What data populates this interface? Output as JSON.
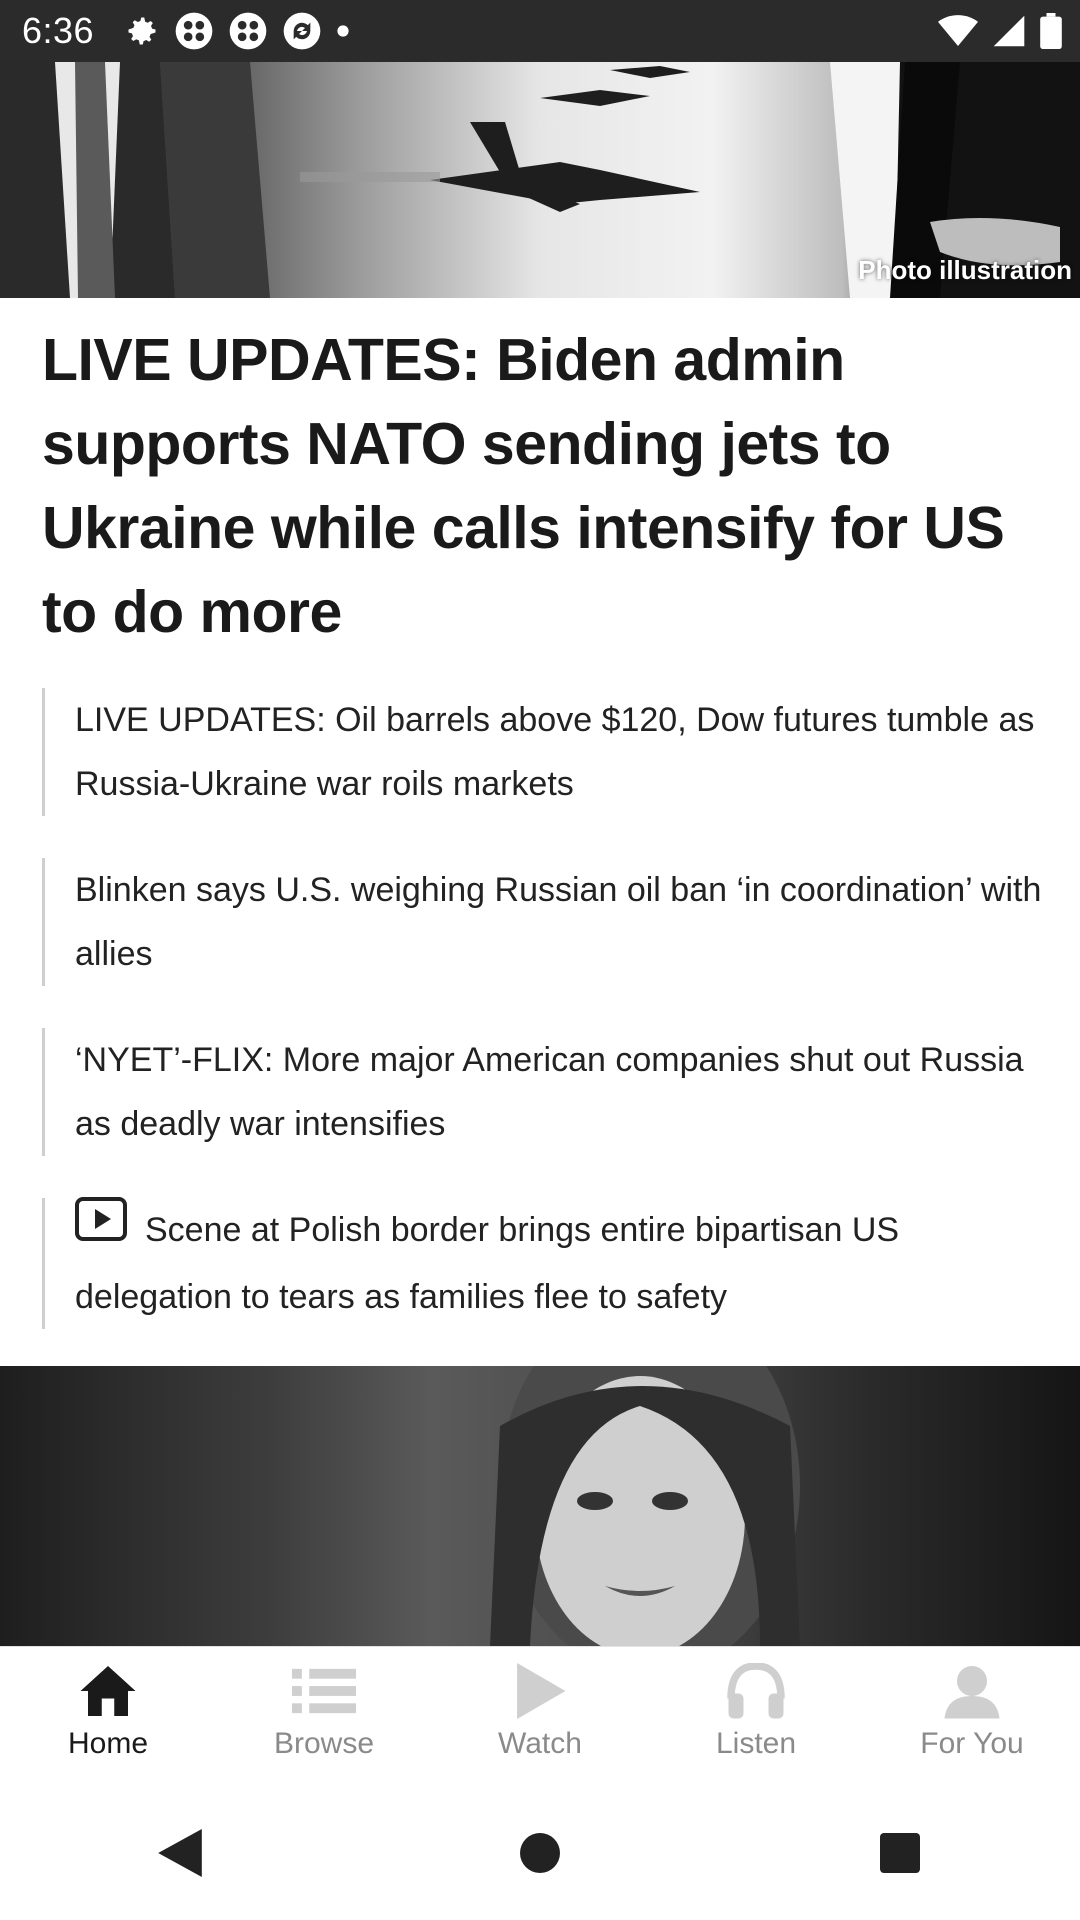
{
  "status_bar": {
    "time": "6:36",
    "left_icons": [
      "gear-icon",
      "app-icon",
      "app-icon",
      "sync-icon",
      "dot-icon"
    ],
    "right_icons": [
      "wifi-icon",
      "signal-icon",
      "battery-icon"
    ]
  },
  "hero": {
    "caption": "Photo illustration"
  },
  "article": {
    "headline": "LIVE UPDATES: Biden admin supports NATO sending jets to Ukraine while calls intensify for US to do more",
    "related": [
      {
        "text": "LIVE UPDATES: Oil barrels above $120, Dow futures tumble as Russia-Ukraine war roils markets",
        "video": false
      },
      {
        "text": "Blinken says U.S. weighing Russian oil ban ‘in coordination’ with allies",
        "video": false
      },
      {
        "text": "‘NYET’-FLIX: More major American companies shut out Russia as deadly war intensifies",
        "video": false
      },
      {
        "text": "Scene at Polish border brings entire bipartisan US delegation to tears as families flee to safety",
        "video": true
      }
    ]
  },
  "bottom_nav": {
    "items": [
      {
        "label": "Home",
        "icon": "home-icon",
        "active": true
      },
      {
        "label": "Browse",
        "icon": "list-icon",
        "active": false
      },
      {
        "label": "Watch",
        "icon": "play-icon",
        "active": false
      },
      {
        "label": "Listen",
        "icon": "headphones-icon",
        "active": false
      },
      {
        "label": "For You",
        "icon": "person-icon",
        "active": false
      }
    ]
  },
  "colors": {
    "status_bar_bg": "#2b2b2b",
    "active_nav": "#1a1a1a",
    "inactive_nav": "#8a8a8a",
    "related_border": "#cfcfcf"
  }
}
